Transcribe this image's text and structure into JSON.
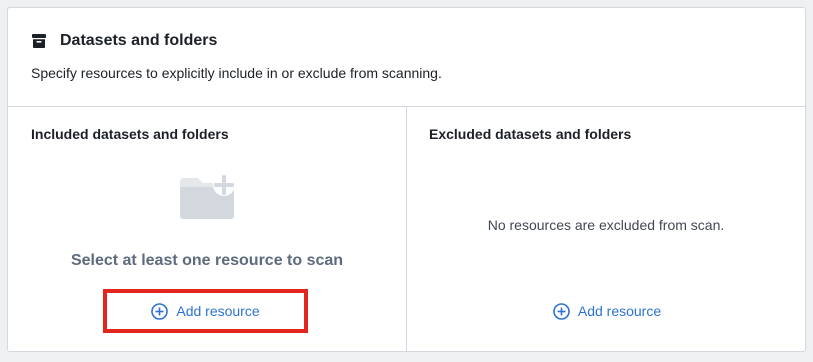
{
  "header": {
    "title": "Datasets and folders",
    "title_icon": "archive-box-icon",
    "subtitle": "Specify resources to explicitly include in or exclude from scanning."
  },
  "included": {
    "title": "Included datasets and folders",
    "empty_icon": "folder-add-icon",
    "empty_title": "Select at least one resource to scan",
    "add_label": "Add resource",
    "add_icon": "plus-circle-icon",
    "highlighted": true
  },
  "excluded": {
    "title": "Excluded datasets and folders",
    "empty_note": "No resources are excluded from scan.",
    "add_label": "Add resource",
    "add_icon": "plus-circle-icon"
  },
  "colors": {
    "accent": "#2d72d2",
    "highlight_border": "#e0261d",
    "muted_text": "#5f6b7c",
    "divider": "#d3d8de"
  }
}
